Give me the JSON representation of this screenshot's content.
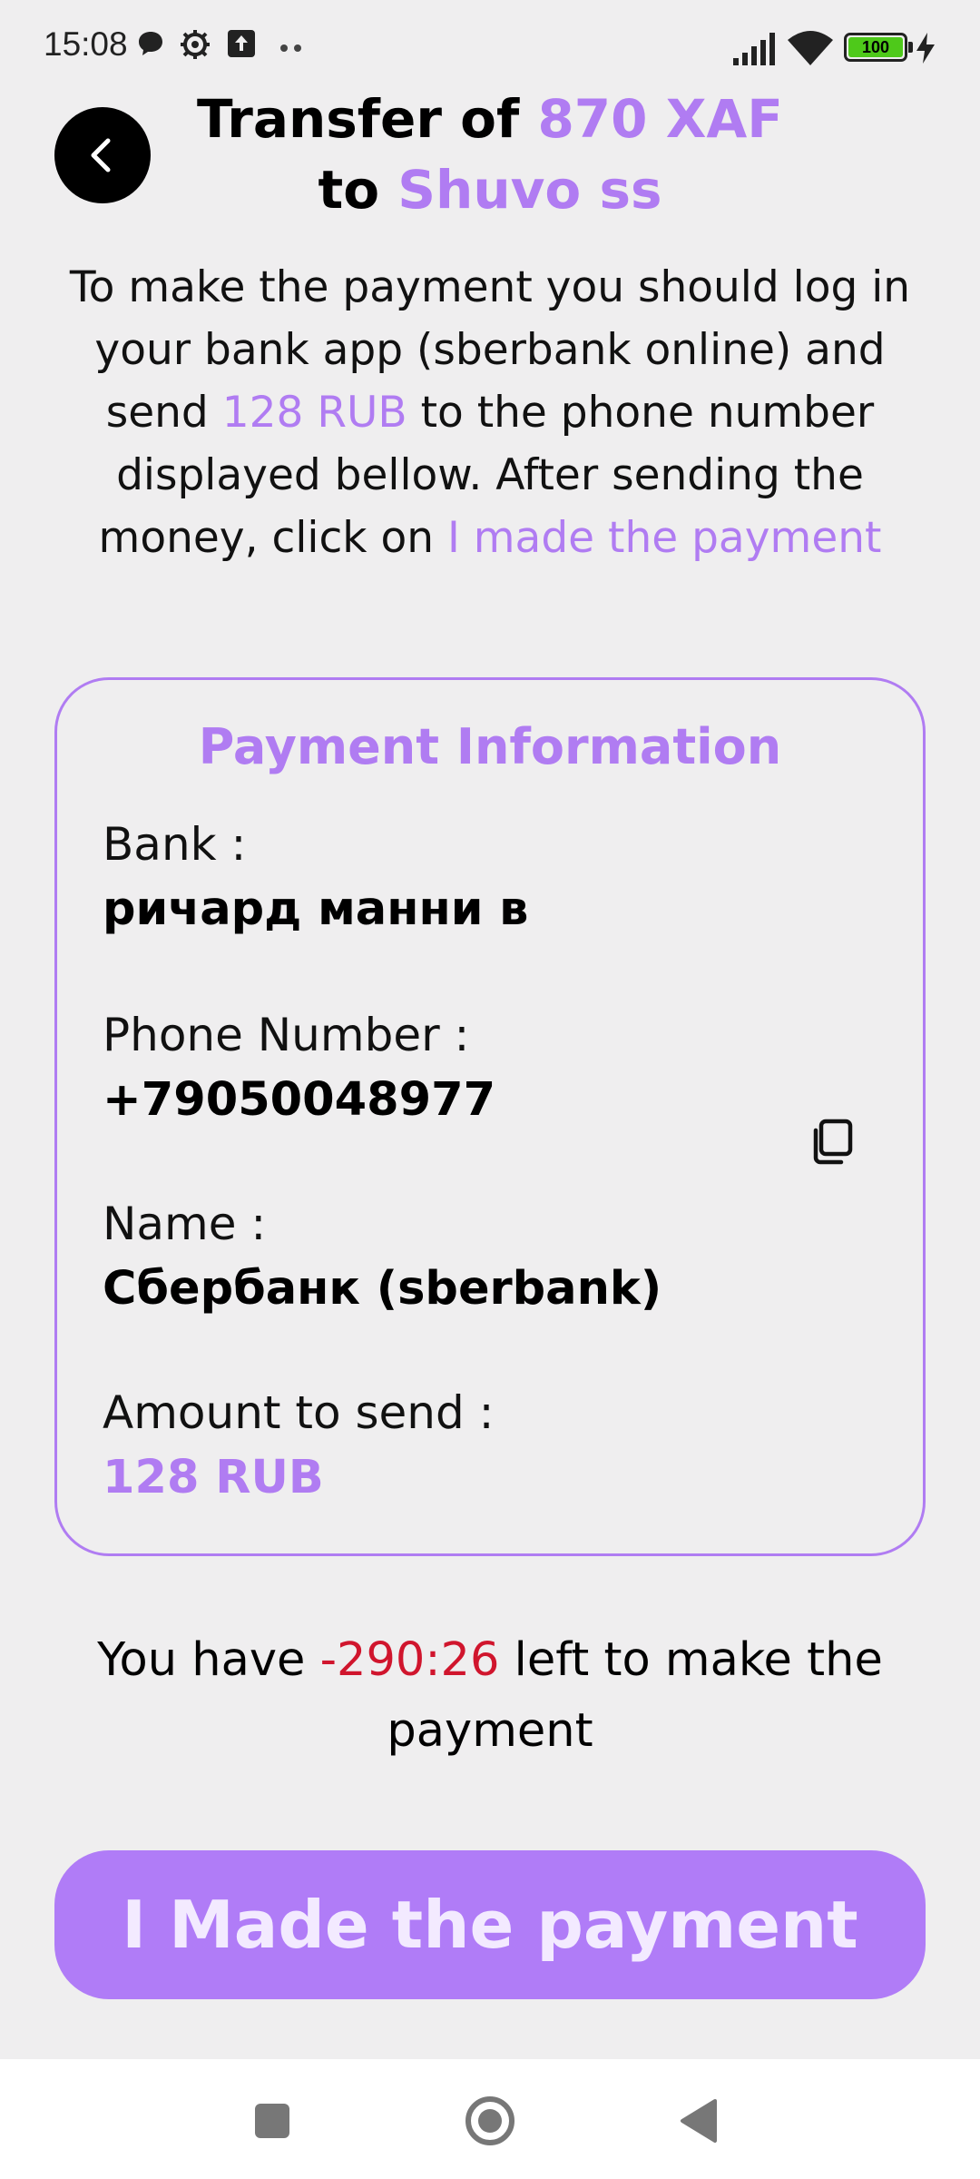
{
  "status_bar": {
    "time": "15:08",
    "icons": [
      "chat-bubble-icon",
      "gear-icon",
      "upload-icon",
      "more-dots-icon",
      "signal-icon",
      "wifi-icon",
      "battery-icon",
      "charging-icon"
    ],
    "battery_level": "100",
    "battery_color": "#4ec91a"
  },
  "header": {
    "title_prefix": "Transfer of ",
    "amount": "870 XAF",
    "title_to": "to ",
    "recipient": "Shuvo ss"
  },
  "instructions": {
    "part1": "To make the payment you should log in your bank app (sberbank online) and send ",
    "amount": "128 RUB",
    "part2": " to the phone number displayed bellow. After sending the money, click on ",
    "link": "I made the payment"
  },
  "card": {
    "title": "Payment Information",
    "bank_label": "Bank :",
    "bank_value": "ричард манни в",
    "phone_label": "Phone Number :",
    "phone_value": "+79050048977",
    "name_label": "Name :",
    "name_value": "Сбербанк (sberbank)",
    "amount_label": "Amount to send :",
    "amount_value": "128 RUB"
  },
  "timer": {
    "prefix": "You have ",
    "time_left": "-290:26",
    "suffix": " left to make the payment"
  },
  "action_button": {
    "label": "I Made the payment"
  },
  "colors": {
    "accent": "#b07cf2",
    "danger": "#d0152d",
    "background": "#efeeef",
    "button": "#b07cf7"
  }
}
